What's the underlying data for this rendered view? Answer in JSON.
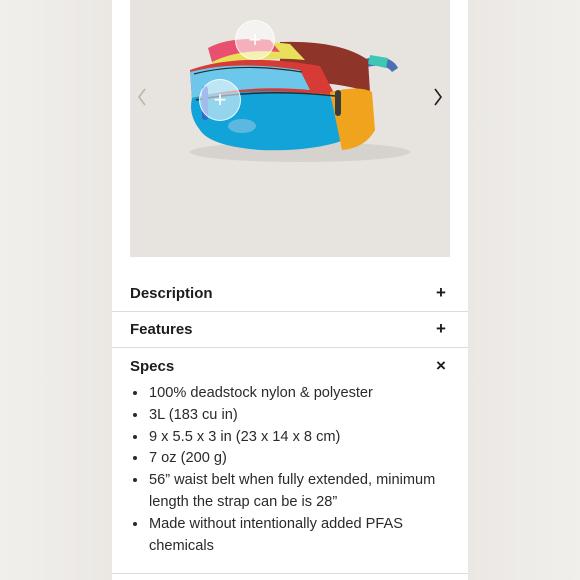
{
  "accordion": [
    {
      "label": "Description",
      "toggle": "+"
    },
    {
      "label": "Features",
      "toggle": "+"
    },
    {
      "label": "Specs",
      "toggle": "×"
    }
  ],
  "specs": [
    "100% deadstock nylon & polyester",
    "3L (183 cu in)",
    "9 x 5.5 x 3 in (23 x 14 x 8 cm)",
    "7 oz (200 g)",
    "56” waist belt when fully extended, minimum length the strap can be is 28”",
    "Made without intentionally added PFAS chemicals"
  ],
  "icons": {
    "prev": "chevron-left-icon",
    "next": "chevron-right-icon",
    "hotspot": "plus-icon"
  },
  "colors": {
    "gallery_bg": "#e7e4df",
    "text": "#1d1d1d",
    "divider": "#dcdcdc"
  }
}
